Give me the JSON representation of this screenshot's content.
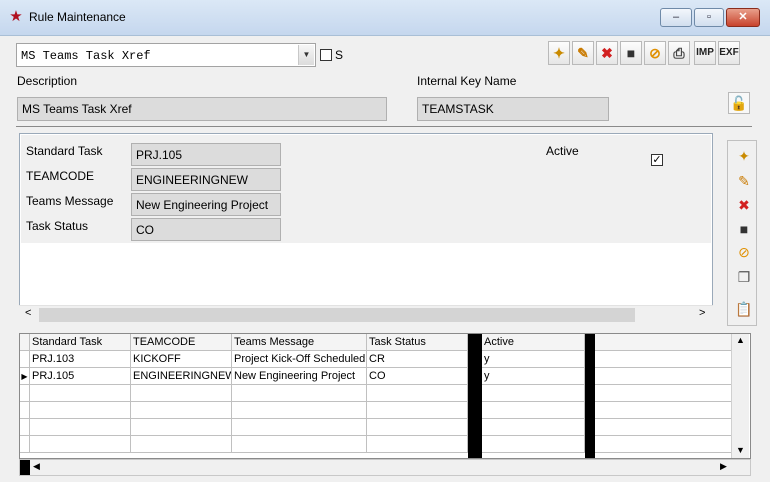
{
  "window": {
    "title": "Rule Maintenance",
    "controls": [
      "–",
      "▫",
      "✕"
    ]
  },
  "rule_select": {
    "value": "MS Teams Task Xref",
    "s_label": "S"
  },
  "toolbar": {
    "buttons": [
      {
        "name": "new-icon",
        "glyph": "✦"
      },
      {
        "name": "edit-icon",
        "glyph": "✎"
      },
      {
        "name": "delete-icon",
        "glyph": "✖"
      },
      {
        "name": "save-icon",
        "glyph": "■"
      },
      {
        "name": "cancel-icon",
        "glyph": "⊘"
      },
      {
        "name": "print-icon",
        "glyph": "⎙"
      }
    ],
    "imp_label": "IMP",
    "exp_label": "EXF"
  },
  "header_fields": {
    "description_label": "Description",
    "description_value": "MS Teams Task Xref",
    "internal_key_label": "Internal Key Name",
    "internal_key_value": "TEAMSTASK",
    "lock_icon": "unlock-icon"
  },
  "detail": {
    "standard_task_label": "Standard Task",
    "standard_task_value": "PRJ.105",
    "teamcode_label": "TEAMCODE",
    "teamcode_value": "ENGINEERINGNEW",
    "teams_message_label": "Teams Message",
    "teams_message_value": "New Engineering Project",
    "task_status_label": "Task Status",
    "task_status_value": "CO",
    "active_label": "Active",
    "active_checked": true
  },
  "grid": {
    "columns": [
      "Standard Task",
      "TEAMCODE",
      "Teams Message",
      "Task Status",
      "Active"
    ],
    "rows": [
      {
        "standard_task": "PRJ.103",
        "teamcode": "KICKOFF",
        "message": "Project Kick-Off Scheduled",
        "status": "CR",
        "active": "y"
      },
      {
        "standard_task": "PRJ.105",
        "teamcode": "ENGINEERINGNEW",
        "message": "New Engineering Project",
        "status": "CO",
        "active": "y",
        "current": true
      }
    ]
  },
  "colors": {
    "accent_red": "#c8432c",
    "field_bg": "#dcdcdc",
    "window_bg": "#f0f0f0"
  }
}
